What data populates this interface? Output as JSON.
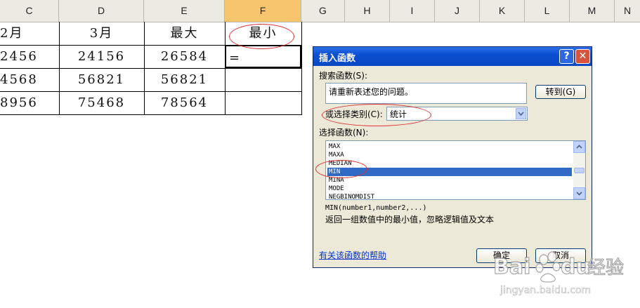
{
  "spreadsheet": {
    "column_headers": [
      "C",
      "D",
      "E",
      "F",
      "G",
      "H",
      "I",
      "J",
      "K",
      "L",
      "M",
      "N"
    ],
    "selected_column": "F",
    "header_row": [
      "2月",
      "3月",
      "最大",
      "最小"
    ],
    "rows": [
      [
        "2456",
        "24156",
        "26584",
        "="
      ],
      [
        "4568",
        "56821",
        "56821",
        ""
      ],
      [
        "8956",
        "75468",
        "78564",
        ""
      ]
    ]
  },
  "dialog": {
    "title": "插入函数",
    "help_glyph": "?",
    "close_glyph": "✕",
    "search_label": "搜索函数(S):",
    "search_value": "请重新表述您的问题。",
    "goto_button": "转到(G)",
    "category_label": "或选择类别(C):",
    "category_value": "统计",
    "select_label": "选择函数(N):",
    "functions": [
      "MAX",
      "MAXA",
      "MEDIAN",
      "MIN",
      "MINA",
      "MODE",
      "NEGBINOMDIST"
    ],
    "selected_function": "MIN",
    "syntax": "MIN(number1,number2,...)",
    "description": "返回一组数值中的最小值，忽略逻辑值及文本",
    "help_link": "有关该函数的帮助",
    "ok_button": "确定",
    "cancel_button": "取消"
  },
  "watermark": {
    "brand": "Baidu经验",
    "url": "jingyan.baidu.com"
  },
  "colors": {
    "annotation": "#e03030",
    "selection": "#316ac5",
    "titlebar": "#0b4fd0",
    "selected_column_header": "#f6c56e"
  }
}
